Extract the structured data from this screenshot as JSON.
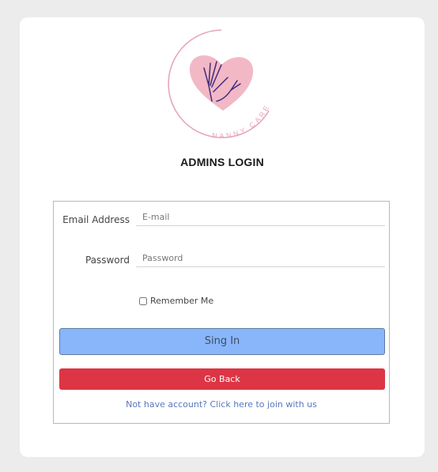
{
  "logo": {
    "brand_text": "NANNY CARE",
    "colors": {
      "ring": "#e7a6b7",
      "heart": "#f2b8c6",
      "hand": "#3f2d7a"
    }
  },
  "page_title": "ADMINS LOGIN",
  "form": {
    "email_label": "Email Address",
    "email_placeholder": "E-mail",
    "password_label": "Password",
    "password_placeholder": "Password",
    "remember_label": "Remember Me",
    "remember_checked": false
  },
  "buttons": {
    "signin_label": "Sing In",
    "back_label": "Go Back"
  },
  "join_link": "Not have account? Click here to join with us",
  "colors": {
    "background": "#ececec",
    "signin": "#89b6fa",
    "back": "#dc3545",
    "link": "#5a78bf"
  }
}
